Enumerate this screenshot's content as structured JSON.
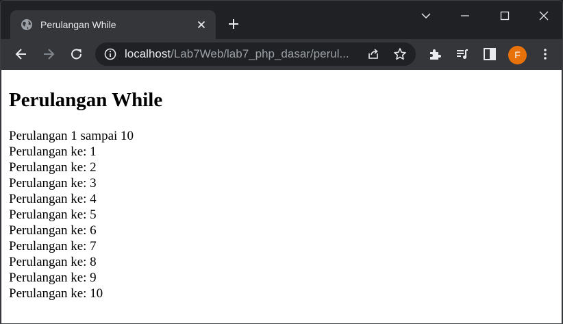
{
  "browser": {
    "tab": {
      "title": "Perulangan While",
      "favicon": "globe-icon"
    },
    "address_bar": {
      "host": "localhost",
      "path": "/Lab7Web/lab7_php_dasar/perul..."
    },
    "profile": {
      "initial": "F",
      "color": "#e8710a"
    }
  },
  "page": {
    "heading": "Perulangan While",
    "intro": "Perulangan 1 sampai 10",
    "lines": [
      "Perulangan ke: 1",
      "Perulangan ke: 2",
      "Perulangan ke: 3",
      "Perulangan ke: 4",
      "Perulangan ke: 5",
      "Perulangan ke: 6",
      "Perulangan ke: 7",
      "Perulangan ke: 8",
      "Perulangan ke: 9",
      "Perulangan ke: 10"
    ]
  }
}
